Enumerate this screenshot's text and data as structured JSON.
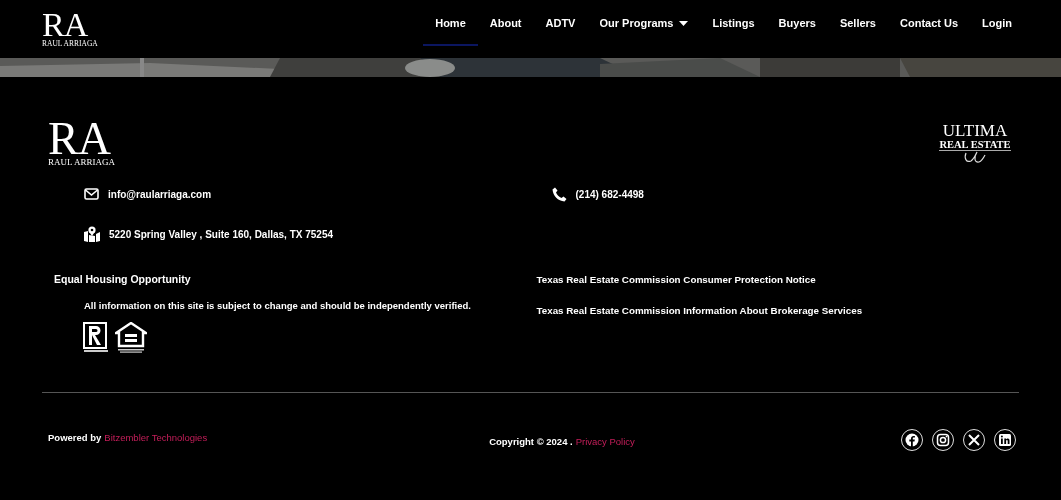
{
  "header": {
    "logo": {
      "monogram": "RA",
      "name": "RAUL ARRIAGA"
    },
    "nav": [
      {
        "label": "Home",
        "selected": true,
        "dropdown": false
      },
      {
        "label": "About",
        "selected": false,
        "dropdown": false
      },
      {
        "label": "ADTV",
        "selected": false,
        "dropdown": false
      },
      {
        "label": "Our Programs",
        "selected": false,
        "dropdown": true
      },
      {
        "label": "Listings",
        "selected": false,
        "dropdown": false
      },
      {
        "label": "Buyers",
        "selected": false,
        "dropdown": false
      },
      {
        "label": "Sellers",
        "selected": false,
        "dropdown": false
      },
      {
        "label": "Contact Us",
        "selected": false,
        "dropdown": false
      },
      {
        "label": "Login",
        "selected": false,
        "dropdown": false
      }
    ]
  },
  "footer": {
    "logo": {
      "monogram": "RA",
      "name": "RAUL ARRIAGA"
    },
    "partner_logo": {
      "line_1": "ULTIMA",
      "line_2": "REAL ESTATE"
    },
    "email": "info@raularriaga.com",
    "phone": "(214) 682-4498",
    "address": "5220 Spring Valley , Suite 160, Dallas, TX 75254",
    "equal_housing": "Equal Housing Opportunity",
    "disclaimer": "All information on this site is subject to change and should be independently verified.",
    "notices": [
      "Texas Real Estate Commission Consumer Protection Notice",
      "Texas Real Estate Commission Information About Brokerage Services"
    ],
    "powered_by": {
      "label": "Powered by",
      "link": "Bitzembler Technologies"
    },
    "copyright": {
      "text": "Copyright © 2024 .",
      "link": "Privacy Policy"
    },
    "social": [
      {
        "kind": "facebook"
      },
      {
        "kind": "instagram"
      },
      {
        "kind": "x"
      },
      {
        "kind": "linkedin"
      }
    ]
  }
}
